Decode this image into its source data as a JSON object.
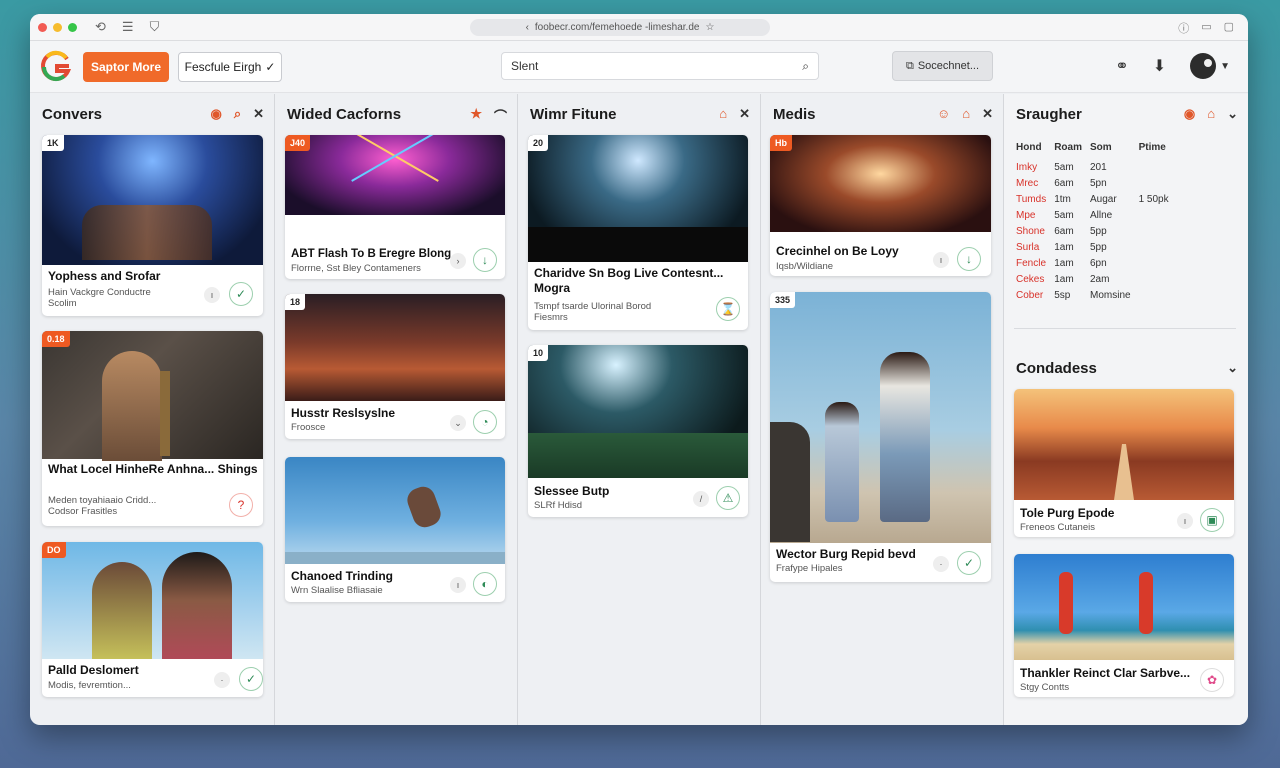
{
  "browser": {
    "url": "foobecr.com/femehoede -limeshar.de"
  },
  "toolbar": {
    "primary_button": "Saptor More",
    "select_label": "Fescfule Eirgh",
    "search_placeholder": "Slent",
    "screen_button": "Socechnet..."
  },
  "columns": [
    {
      "title": "Convers",
      "cards": [
        {
          "badge": "1K",
          "title": "Yophess and Srofar",
          "sub": "Hain Vackgre Conductre Scolim"
        },
        {
          "badge": "0.18",
          "title": "What Locel HinheRe Anhna... Shings",
          "sub": "Meden toyahiaaio Cridd... Codsor Frasitles"
        },
        {
          "badge": "DO",
          "title": "Palld Deslomert",
          "sub": "Modis, fevremtion..."
        }
      ]
    },
    {
      "title": "Wided Cacforns",
      "cards": [
        {
          "badge": "J40",
          "title": "ABT Flash To B Eregre Blong",
          "sub": "Florrne, Sst Bley Contameners"
        },
        {
          "badge": "18",
          "title": "Husstr Reslsyslne",
          "sub": "Froosce"
        },
        {
          "badge": "",
          "title": "Chanoed Trinding",
          "sub": "Wrn Slaalise Bfliasaie"
        }
      ]
    },
    {
      "title": "Wimr Fitune",
      "cards": [
        {
          "badge": "20",
          "title": "Charidve Sn Bog Live Contesnt... Mogra",
          "sub": "Tsmpf tsarde Ulorinal Borod Fiesmrs"
        },
        {
          "badge": "10",
          "title": "Slessee Butp",
          "sub": "SLRf Hdisd"
        }
      ]
    },
    {
      "title": "Medis",
      "cards": [
        {
          "badge": "Hb",
          "title": "Crecinhel on Be Loyy",
          "sub": "Iqsb/Wildiane"
        },
        {
          "badge": "335",
          "title": "Wector Burg Repid bevd",
          "sub": "Frafype Hipales"
        }
      ]
    }
  ],
  "side_panel": {
    "title": "Sraugher",
    "schedule_headers": [
      "Hond",
      "Roam",
      "Som",
      "Ptime"
    ],
    "schedule_rows": [
      [
        "Imky",
        "5am",
        "201",
        ""
      ],
      [
        "Mrec",
        "6am",
        "5pn",
        ""
      ],
      [
        "Tumds",
        "1tm",
        "Augar",
        "1 50pk"
      ],
      [
        "Mpe",
        "5am",
        "Allne",
        ""
      ],
      [
        "Shone",
        "6am",
        "5pp",
        ""
      ],
      [
        "Surla",
        "1am",
        "5pp",
        ""
      ],
      [
        "Fencle",
        "1am",
        "6pn",
        ""
      ],
      [
        "Cekes",
        "1am",
        "2am",
        ""
      ],
      [
        "Cober",
        "5sp",
        "Momsine",
        ""
      ]
    ],
    "section2_title": "Condadess",
    "cards": [
      {
        "title": "Tole Purg Epode",
        "sub": "Freneos Cutaneis"
      },
      {
        "title": "Thankler Reinct Clar Sarbve...",
        "sub": "Stgy Contts"
      }
    ]
  },
  "colors": {
    "accent": "#f06a2a",
    "schedule_name": "#d8322a",
    "action_green": "#2e8b57"
  }
}
